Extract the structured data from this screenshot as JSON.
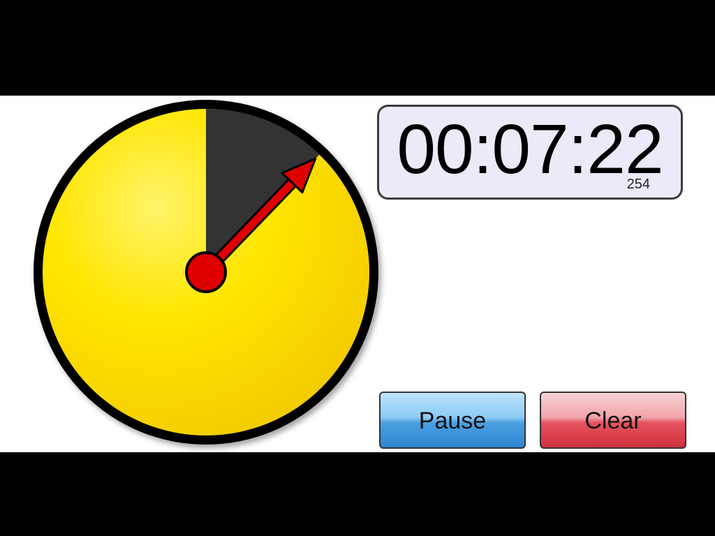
{
  "timer": {
    "time_display": "00:07:22",
    "sub_count": "254",
    "elapsed_fraction_of_dial": 0.122
  },
  "buttons": {
    "pause_label": "Pause",
    "clear_label": "Clear"
  },
  "colors": {
    "dial_face": "#ffe100",
    "dial_rim": "#000000",
    "elapsed_wedge": "#333333",
    "hand": "#e00000",
    "pause_button": "#4a9fe0",
    "clear_button": "#e4545f",
    "readout_background": "#eaeaf8"
  },
  "icons": {
    "dial": "timer-dial-icon",
    "hand": "timer-hand-icon"
  }
}
